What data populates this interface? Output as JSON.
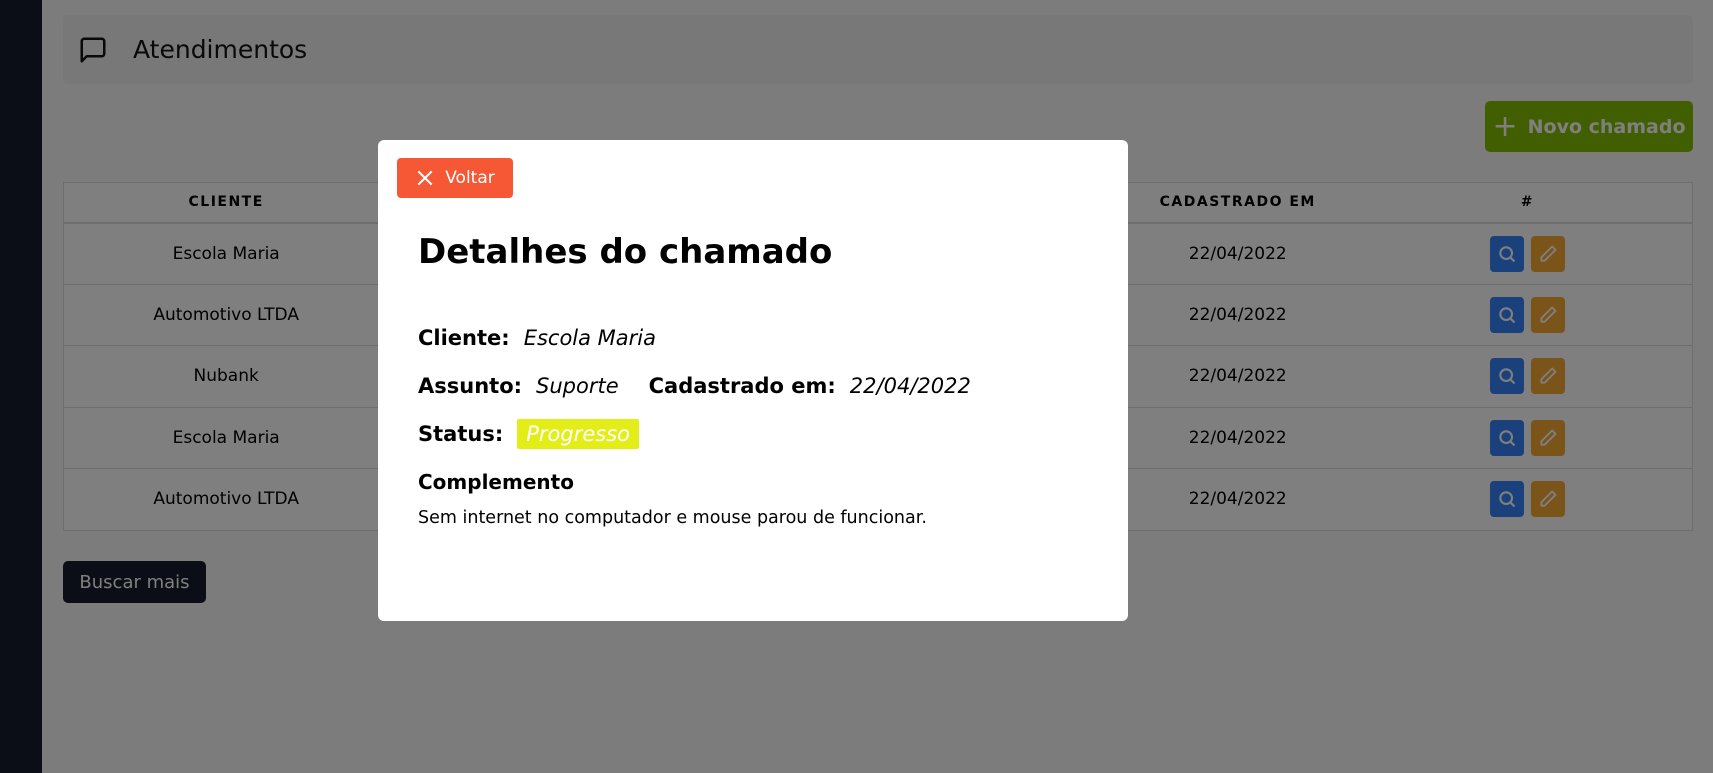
{
  "page": {
    "title": "Atendimentos",
    "new_button_label": "Novo chamado",
    "more_button_label": "Buscar mais"
  },
  "table": {
    "headers": [
      "CLIENTE",
      "CADASTRADO EM",
      "#"
    ],
    "rows": [
      {
        "cliente": "Escola Maria",
        "cadastrado": "22/04/2022"
      },
      {
        "cliente": "Automotivo LTDA",
        "cadastrado": "22/04/2022"
      },
      {
        "cliente": "Nubank",
        "cadastrado": "22/04/2022"
      },
      {
        "cliente": "Escola Maria",
        "cadastrado": "22/04/2022"
      },
      {
        "cliente": "Automotivo LTDA",
        "cadastrado": "22/04/2022"
      }
    ]
  },
  "modal": {
    "close_label": "Voltar",
    "title": "Detalhes do chamado",
    "cliente_label": "Cliente:",
    "cliente_value": "Escola Maria",
    "assunto_label": "Assunto:",
    "assunto_value": "Suporte",
    "cadastrado_label": "Cadastrado em:",
    "cadastrado_value": "22/04/2022",
    "status_label": "Status:",
    "status_value": "Progresso",
    "complemento_label": "Complemento",
    "complemento_value": "Sem internet no computador e mouse parou de funcionar."
  },
  "colors": {
    "sidebar": "#181c2e",
    "new_button": "#83bf02",
    "search_action": "#3583f6",
    "edit_action": "#f6a935",
    "close_button": "#f65835",
    "status_badge": "#e3ee19"
  },
  "icons": {
    "title": "message-square-icon",
    "new_button": "plus-icon",
    "row_search": "search-icon",
    "row_edit": "pencil-icon",
    "close": "close-icon"
  }
}
